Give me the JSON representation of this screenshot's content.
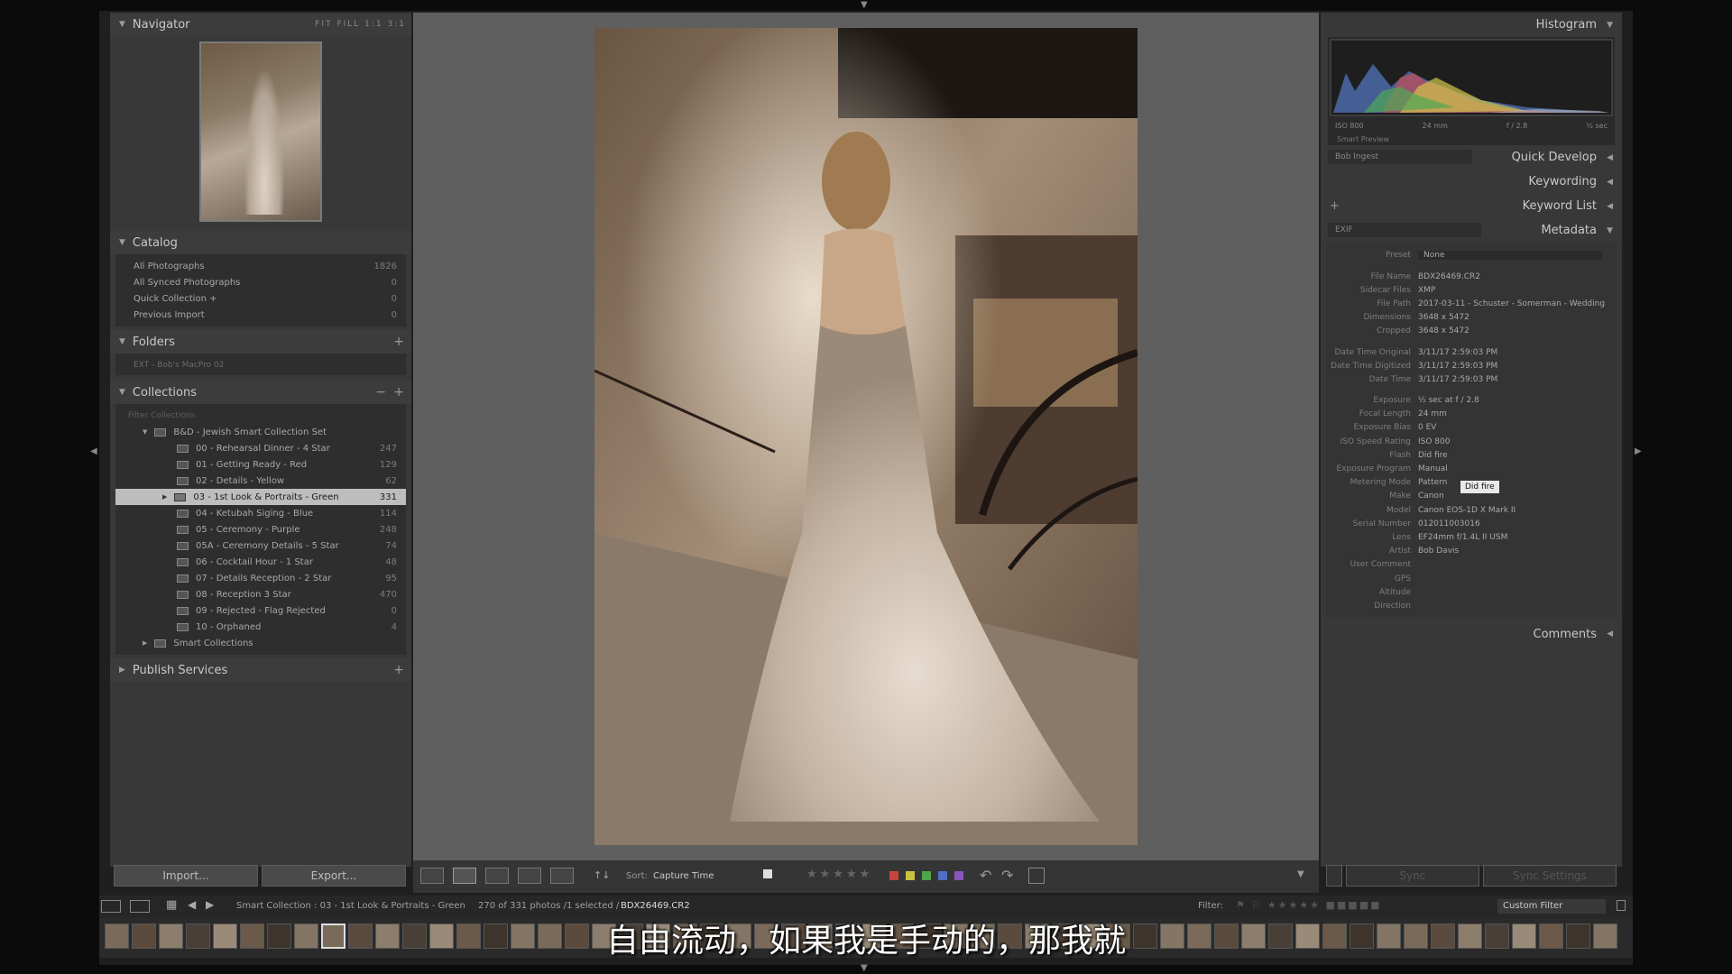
{
  "navigator": {
    "title": "Navigator",
    "zoom": "FIT  FILL  1:1  3:1"
  },
  "catalog": {
    "title": "Catalog",
    "items": [
      {
        "label": "All Photographs",
        "count": "1826"
      },
      {
        "label": "All Synced Photographs",
        "count": "0"
      },
      {
        "label": "Quick Collection +",
        "count": "0"
      },
      {
        "label": "Previous Import",
        "count": "0"
      }
    ]
  },
  "folders": {
    "title": "Folders",
    "drive": "EXT - Bob's MacPro 02"
  },
  "collections": {
    "title": "Collections",
    "filter_placeholder": "Filter Collections",
    "set": "B&D - Jewish Smart Collection Set",
    "items": [
      {
        "label": "00 - Rehearsal Dinner - 4 Star",
        "count": "247"
      },
      {
        "label": "01 - Getting Ready - Red",
        "count": "129"
      },
      {
        "label": "02 - Details - Yellow",
        "count": "62"
      },
      {
        "label": "03 - 1st Look & Portraits - Green",
        "count": "331"
      },
      {
        "label": "04 - Ketubah Siging - Blue",
        "count": "114"
      },
      {
        "label": "05 - Ceremony - Purple",
        "count": "248"
      },
      {
        "label": "05A - Ceremony Details - 5 Star",
        "count": "74"
      },
      {
        "label": "06 - Cocktail Hour - 1 Star",
        "count": "48"
      },
      {
        "label": "07 - Details Reception - 2 Star",
        "count": "95"
      },
      {
        "label": "08 - Reception 3 Star",
        "count": "470"
      },
      {
        "label": "09 - Rejected - Flag Rejected",
        "count": "0"
      },
      {
        "label": "10 - Orphaned",
        "count": "4"
      }
    ],
    "smart": "Smart Collections"
  },
  "publish": {
    "title": "Publish Services"
  },
  "left_buttons": {
    "import": "Import...",
    "export": "Export..."
  },
  "toolbar": {
    "sort_label": "Sort:",
    "sort_value": "Capture Time"
  },
  "histogram": {
    "title": "Histogram",
    "iso": "ISO 800",
    "focal": "24 mm",
    "fstop": "f / 2.8",
    "shutter": "½ sec",
    "smart_preview": "Smart Preview"
  },
  "right_sections": {
    "preset_select": "Bob Ingest",
    "quick_develop": "Quick Develop",
    "keywording": "Keywording",
    "keyword_list": "Keyword List",
    "exif_select": "EXIF",
    "metadata": "Metadata",
    "comments": "Comments"
  },
  "metadata": {
    "preset": {
      "k": "Preset",
      "v": "None"
    },
    "group1": [
      {
        "k": "File Name",
        "v": "BDX26469.CR2"
      },
      {
        "k": "Sidecar Files",
        "v": "XMP"
      },
      {
        "k": "File Path",
        "v": "2017-03-11 - Schuster - Somerman - Wedding"
      },
      {
        "k": "Dimensions",
        "v": "3648 x 5472"
      },
      {
        "k": "Cropped",
        "v": "3648 x 5472"
      }
    ],
    "group2": [
      {
        "k": "Date Time Original",
        "v": "3/11/17 2:59:03 PM"
      },
      {
        "k": "Date Time Digitized",
        "v": "3/11/17 2:59:03 PM"
      },
      {
        "k": "Date Time",
        "v": "3/11/17 2:59:03 PM"
      }
    ],
    "group3": [
      {
        "k": "Exposure",
        "v": "½ sec at f / 2.8"
      },
      {
        "k": "Focal Length",
        "v": "24 mm"
      },
      {
        "k": "Exposure Bias",
        "v": "0 EV"
      },
      {
        "k": "ISO Speed Rating",
        "v": "ISO 800"
      },
      {
        "k": "Flash",
        "v": "Did fire"
      },
      {
        "k": "Exposure Program",
        "v": "Manual"
      },
      {
        "k": "Metering Mode",
        "v": "Pattern"
      },
      {
        "k": "Make",
        "v": "Canon"
      },
      {
        "k": "Model",
        "v": "Canon EOS-1D X Mark II"
      },
      {
        "k": "Serial Number",
        "v": "012011003016"
      },
      {
        "k": "Lens",
        "v": "EF24mm f/1.4L II USM"
      },
      {
        "k": "Artist",
        "v": "Bob Davis"
      },
      {
        "k": "User Comment",
        "v": ""
      },
      {
        "k": "GPS",
        "v": ""
      },
      {
        "k": "Altitude",
        "v": ""
      },
      {
        "k": "Direction",
        "v": ""
      }
    ],
    "tooltip": "Did fire"
  },
  "right_buttons": {
    "sync": "Sync",
    "sync_settings": "Sync Settings"
  },
  "filmbar": {
    "source": "Smart Collection : 03 - 1st Look & Portraits - Green",
    "count": "270 of 331 photos /1 selected /",
    "file": "BDX26469.CR2",
    "filter_label": "Filter:",
    "filter_value": "Custom Filter"
  },
  "subtitle": "自由流动，如果我是手动的，那我就",
  "colors": {
    "label_red": "#c4453d",
    "label_yellow": "#c9c042",
    "label_green": "#4fa64a",
    "label_blue": "#4f6fc4",
    "label_purple": "#8a55b8"
  }
}
